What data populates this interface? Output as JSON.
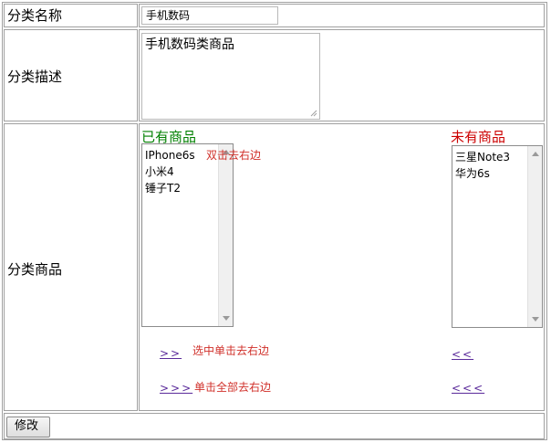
{
  "form": {
    "name_label": "分类名称",
    "name_value": "手机数码",
    "desc_label": "分类描述",
    "desc_value": "手机数码类商品",
    "goods_label": "分类商品"
  },
  "existing": {
    "heading": "已有商品",
    "heading_color": "#008000",
    "items": [
      "IPhone6s",
      "小米4",
      "锤子T2"
    ],
    "hint": "双击去右边"
  },
  "missing": {
    "heading": "未有商品",
    "heading_color": "#cc0000",
    "items": [
      "三星Note3",
      "华为6s"
    ]
  },
  "actions": {
    "move_selected_right": ">>",
    "move_selected_hint": "选中单击去右边",
    "move_all_right": ">>>",
    "move_all_hint": "单击全部去右边",
    "move_selected_left": "<<",
    "move_all_left": "<<<"
  },
  "submit_label": "修改"
}
